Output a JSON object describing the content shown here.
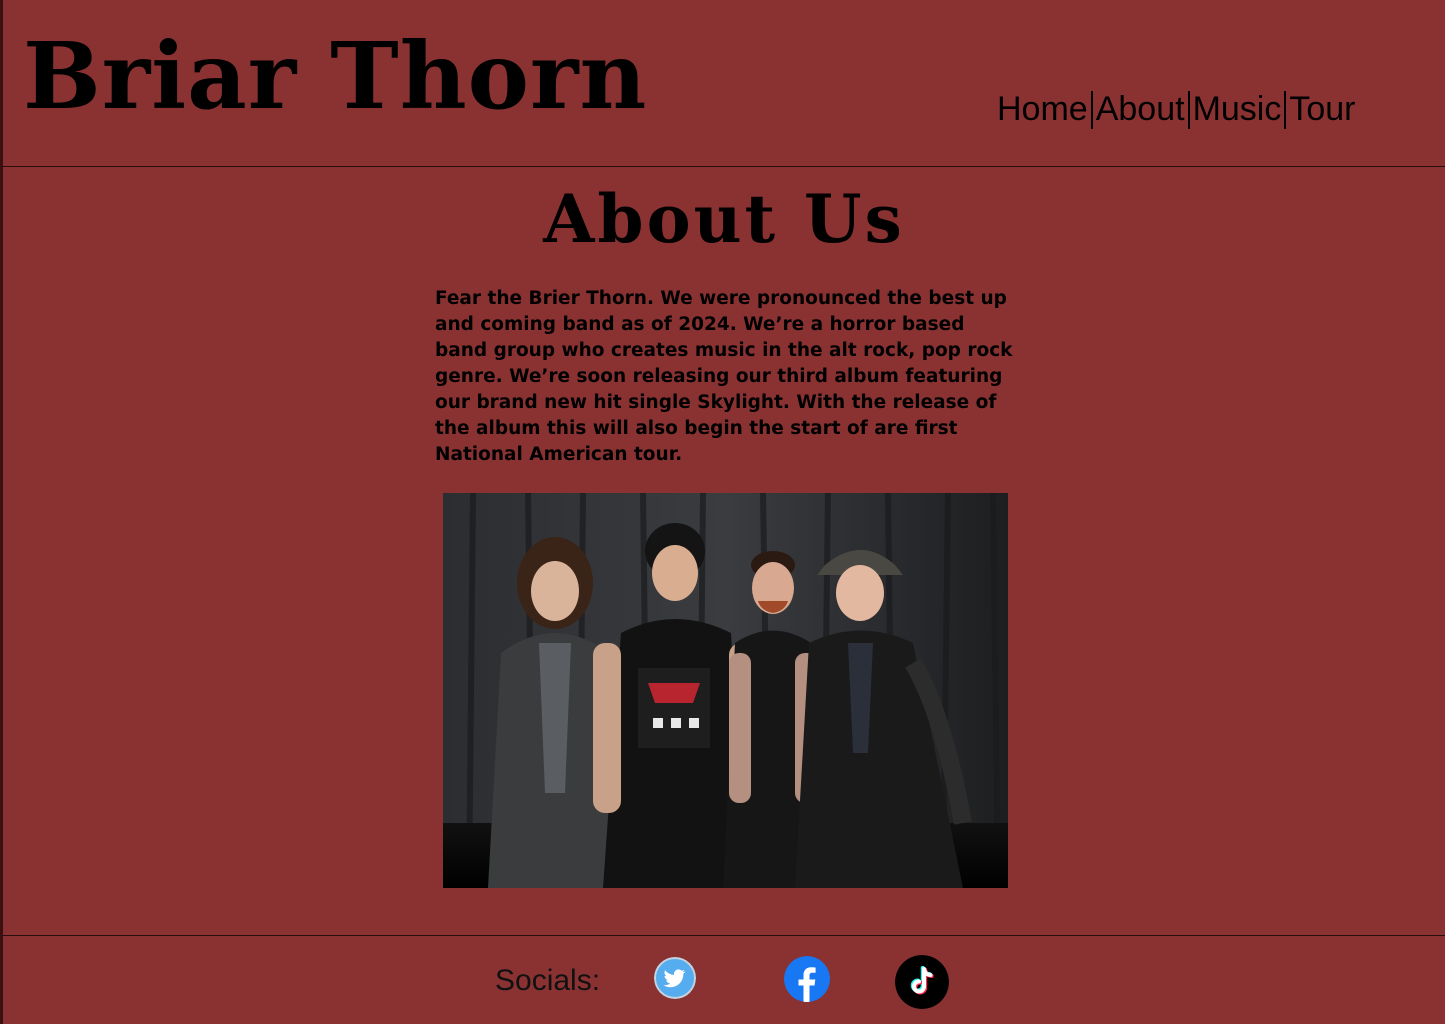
{
  "header": {
    "brand": "Briar Thorn",
    "nav": [
      {
        "label": "Home"
      },
      {
        "label": "About"
      },
      {
        "label": "Music"
      },
      {
        "label": "Tour"
      }
    ]
  },
  "about": {
    "title": "About Us",
    "body": "Fear the Brier Thorn. We were pronounced the best up and coming band as of 2024. We’re a horror based band group who creates music in the alt rock, pop rock genre. We’re soon releasing our third album featuring our brand new hit single Skylight. With the release of the album this will also begin the start of are first National American tour."
  },
  "footer": {
    "socials_label": "Socials:",
    "icons": [
      "twitter-icon",
      "facebook-icon",
      "tiktok-icon"
    ]
  },
  "colors": {
    "background": "#8a3232",
    "text": "#000000",
    "twitter": "#55acee",
    "facebook": "#1877f2",
    "tiktok": "#000000"
  }
}
